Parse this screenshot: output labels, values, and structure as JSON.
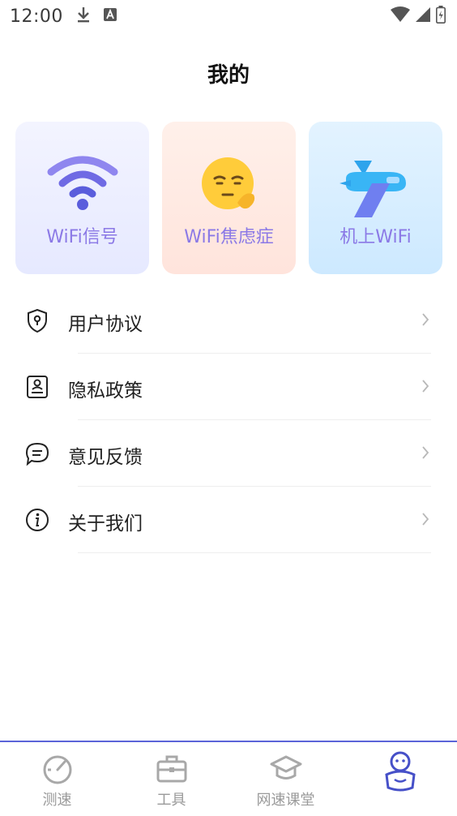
{
  "status_bar": {
    "time": "12:00"
  },
  "header": {
    "title": "我的"
  },
  "cards": [
    {
      "label": "WiFi信号",
      "icon": "wifi-icon"
    },
    {
      "label": "WiFi焦虑症",
      "icon": "anxious-face-icon"
    },
    {
      "label": "机上WiFi",
      "icon": "airplane-icon"
    }
  ],
  "menu": [
    {
      "label": "用户协议",
      "icon": "shield-lock-icon"
    },
    {
      "label": "隐私政策",
      "icon": "privacy-document-icon"
    },
    {
      "label": "意见反馈",
      "icon": "chat-bubble-icon"
    },
    {
      "label": "关于我们",
      "icon": "info-icon"
    }
  ],
  "tabbar": {
    "items": [
      {
        "label": "测速",
        "icon": "speedometer-icon",
        "active": false
      },
      {
        "label": "工具",
        "icon": "toolbox-icon",
        "active": false
      },
      {
        "label": "网速课堂",
        "icon": "graduation-cap-icon",
        "active": false
      },
      {
        "label": "",
        "icon": "profile-mascot-icon",
        "active": true
      }
    ]
  },
  "colors": {
    "accent": "#5b64d8",
    "card_label": "#8b79e6",
    "tab_inactive": "#9a9a9a"
  }
}
